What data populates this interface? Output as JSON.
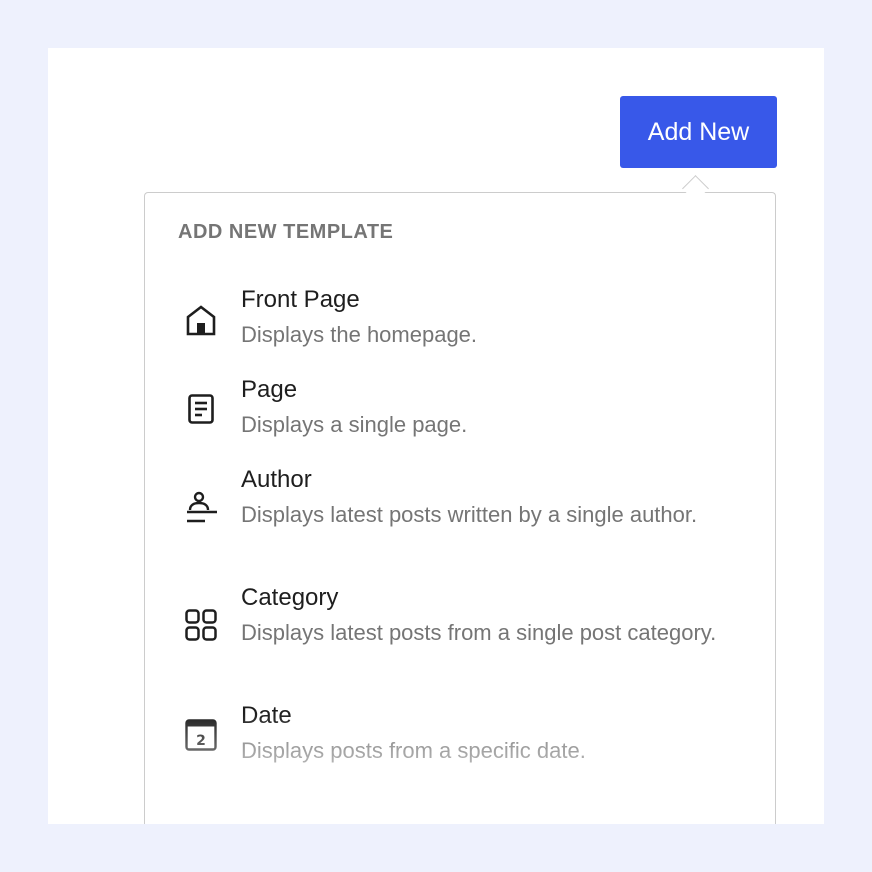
{
  "toolbar": {
    "add_new_label": "Add New"
  },
  "popover": {
    "heading": "ADD NEW TEMPLATE",
    "items": [
      {
        "title": "Front Page",
        "description": "Displays the homepage.",
        "icon": "home-icon"
      },
      {
        "title": "Page",
        "description": "Displays a single page.",
        "icon": "page-icon"
      },
      {
        "title": "Author",
        "description": "Displays latest posts written by a single author.",
        "icon": "author-icon"
      },
      {
        "title": "Category",
        "description": "Displays latest posts from a single post category.",
        "icon": "category-icon"
      },
      {
        "title": "Date",
        "description": "Displays posts from a specific date.",
        "icon": "calendar-icon",
        "icon_text": "2"
      }
    ]
  },
  "colors": {
    "accent": "#3858e9",
    "background": "#eef1fd",
    "title_text": "#1e1e1e",
    "muted_text": "#757575"
  }
}
